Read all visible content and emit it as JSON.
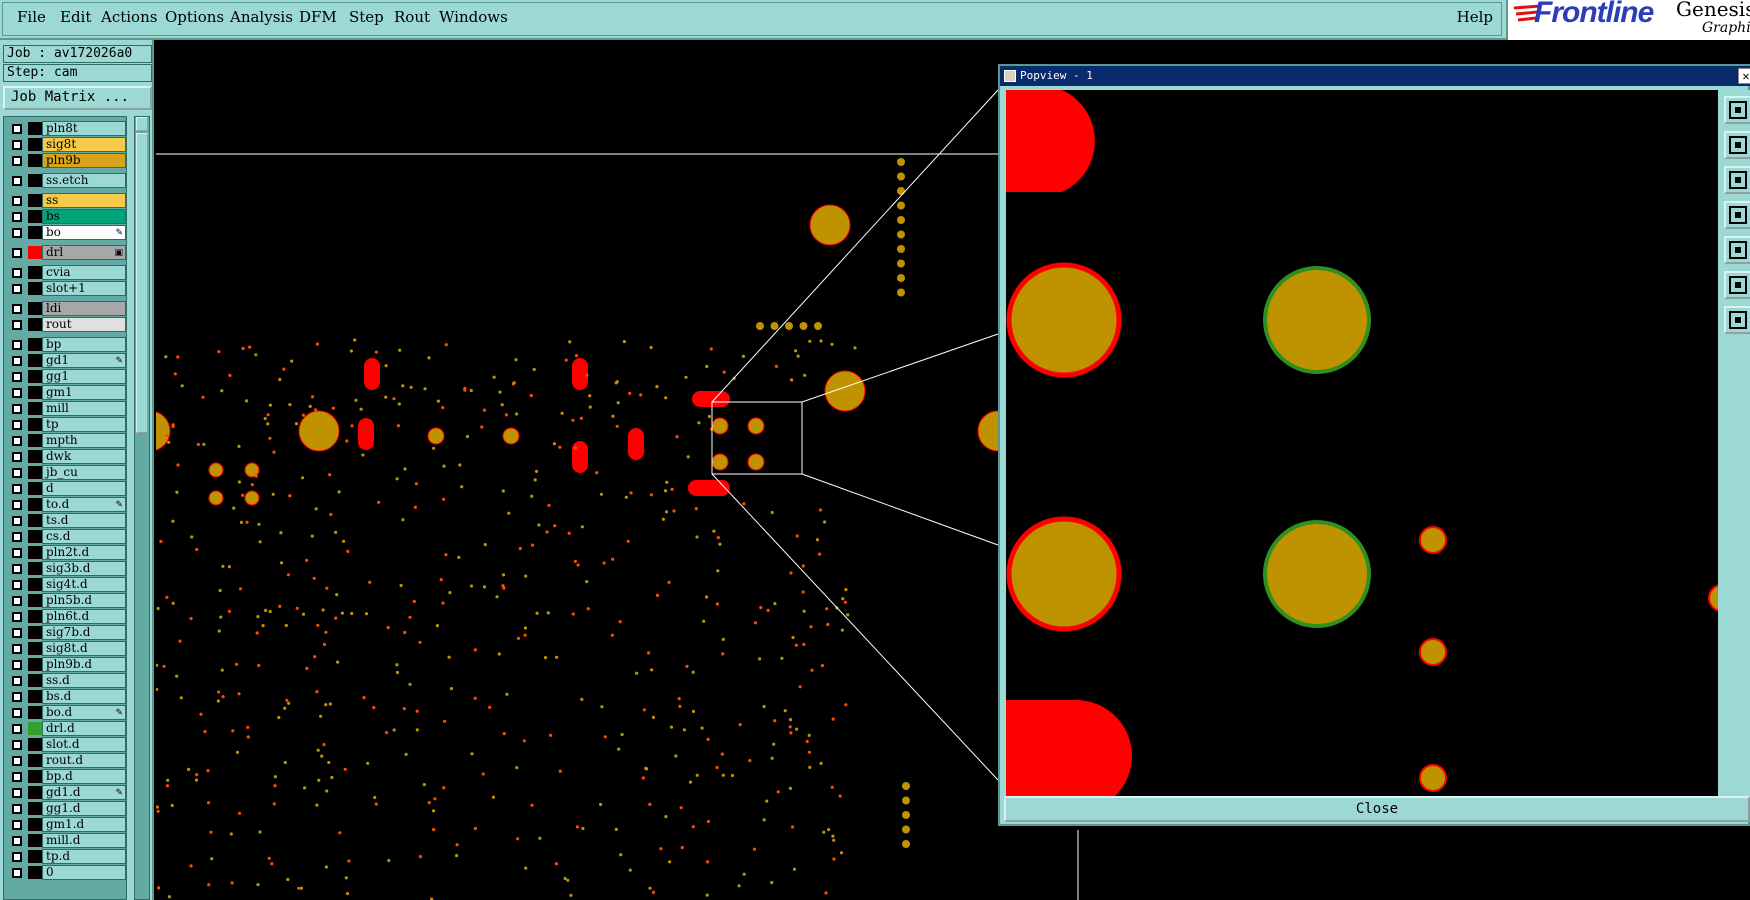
{
  "menubar": {
    "items": [
      {
        "label": "File"
      },
      {
        "label": "Edit"
      },
      {
        "label": "Actions"
      },
      {
        "label": "Options"
      },
      {
        "label": "Analysis"
      },
      {
        "label": "DFM"
      },
      {
        "label": "Step"
      },
      {
        "label": "Rout"
      },
      {
        "label": "Windows"
      }
    ],
    "help_label": "Help"
  },
  "brand": {
    "logo": "Frontline",
    "name": "Genesis",
    "subtitle": "Graphic"
  },
  "job": {
    "job_label": "Job : av172026a0",
    "step_label": "Step: cam",
    "matrix_button": "Job Matrix ..."
  },
  "layers": [
    {
      "name": "pln8t",
      "color": "#000000",
      "bg": "#9cd8d4",
      "mark": ""
    },
    {
      "name": "sig8t",
      "color": "#000000",
      "bg": "#f7c94b",
      "mark": ""
    },
    {
      "name": "pln9b",
      "color": "#000000",
      "bg": "#d8a41c",
      "mark": ""
    },
    {
      "name": "ss.etch",
      "color": "#000000",
      "bg": "#9cd8d4",
      "mark": ""
    },
    {
      "name": "ss",
      "color": "#000000",
      "bg": "#f7c94b",
      "mark": ""
    },
    {
      "name": "bs",
      "color": "#000000",
      "bg": "#00a278",
      "mark": ""
    },
    {
      "name": "bo",
      "color": "#000000",
      "bg": "#ffffff",
      "mark": "✎"
    },
    {
      "name": "drl",
      "color": "#ff0000",
      "bg": "#a8a8a8",
      "mark": "▣"
    },
    {
      "name": "cvia",
      "color": "#000000",
      "bg": "#9cd8d4",
      "mark": ""
    },
    {
      "name": "slot+1",
      "color": "#000000",
      "bg": "#9cd8d4",
      "mark": ""
    },
    {
      "name": "ldi",
      "color": "#000000",
      "bg": "#a8a8a8",
      "mark": ""
    },
    {
      "name": "rout",
      "color": "#000000",
      "bg": "#e0e0e0",
      "mark": ""
    },
    {
      "name": "bp",
      "color": "#000000",
      "bg": "#9cd8d4",
      "mark": ""
    },
    {
      "name": "gd1",
      "color": "#000000",
      "bg": "#9cd8d4",
      "mark": "✎"
    },
    {
      "name": "gg1",
      "color": "#000000",
      "bg": "#9cd8d4",
      "mark": ""
    },
    {
      "name": "gm1",
      "color": "#000000",
      "bg": "#9cd8d4",
      "mark": ""
    },
    {
      "name": "mill",
      "color": "#000000",
      "bg": "#9cd8d4",
      "mark": ""
    },
    {
      "name": "tp",
      "color": "#000000",
      "bg": "#9cd8d4",
      "mark": ""
    },
    {
      "name": "mpth",
      "color": "#000000",
      "bg": "#9cd8d4",
      "mark": ""
    },
    {
      "name": "dwk",
      "color": "#000000",
      "bg": "#9cd8d4",
      "mark": ""
    },
    {
      "name": "jb_cu",
      "color": "#000000",
      "bg": "#9cd8d4",
      "mark": ""
    },
    {
      "name": "d",
      "color": "#000000",
      "bg": "#9cd8d4",
      "mark": ""
    },
    {
      "name": "to.d",
      "color": "#000000",
      "bg": "#9cd8d4",
      "mark": "✎"
    },
    {
      "name": "ts.d",
      "color": "#000000",
      "bg": "#9cd8d4",
      "mark": ""
    },
    {
      "name": "cs.d",
      "color": "#000000",
      "bg": "#9cd8d4",
      "mark": ""
    },
    {
      "name": "pln2t.d",
      "color": "#000000",
      "bg": "#9cd8d4",
      "mark": ""
    },
    {
      "name": "sig3b.d",
      "color": "#000000",
      "bg": "#9cd8d4",
      "mark": ""
    },
    {
      "name": "sig4t.d",
      "color": "#000000",
      "bg": "#9cd8d4",
      "mark": ""
    },
    {
      "name": "pln5b.d",
      "color": "#000000",
      "bg": "#9cd8d4",
      "mark": ""
    },
    {
      "name": "pln6t.d",
      "color": "#000000",
      "bg": "#9cd8d4",
      "mark": ""
    },
    {
      "name": "sig7b.d",
      "color": "#000000",
      "bg": "#9cd8d4",
      "mark": ""
    },
    {
      "name": "sig8t.d",
      "color": "#000000",
      "bg": "#9cd8d4",
      "mark": ""
    },
    {
      "name": "pln9b.d",
      "color": "#000000",
      "bg": "#9cd8d4",
      "mark": ""
    },
    {
      "name": "ss.d",
      "color": "#000000",
      "bg": "#9cd8d4",
      "mark": ""
    },
    {
      "name": "bs.d",
      "color": "#000000",
      "bg": "#9cd8d4",
      "mark": ""
    },
    {
      "name": "bo.d",
      "color": "#000000",
      "bg": "#9cd8d4",
      "mark": "✎"
    },
    {
      "name": "drl.d",
      "color": "#35a02a",
      "bg": "#9cd8d4",
      "mark": ""
    },
    {
      "name": "slot.d",
      "color": "#000000",
      "bg": "#9cd8d4",
      "mark": ""
    },
    {
      "name": "rout.d",
      "color": "#000000",
      "bg": "#9cd8d4",
      "mark": ""
    },
    {
      "name": "bp.d",
      "color": "#000000",
      "bg": "#9cd8d4",
      "mark": ""
    },
    {
      "name": "gd1.d",
      "color": "#000000",
      "bg": "#9cd8d4",
      "mark": "✎"
    },
    {
      "name": "gg1.d",
      "color": "#000000",
      "bg": "#9cd8d4",
      "mark": ""
    },
    {
      "name": "gm1.d",
      "color": "#000000",
      "bg": "#9cd8d4",
      "mark": ""
    },
    {
      "name": "mill.d",
      "color": "#000000",
      "bg": "#9cd8d4",
      "mark": ""
    },
    {
      "name": "tp.d",
      "color": "#000000",
      "bg": "#9cd8d4",
      "mark": ""
    },
    {
      "name": "0",
      "color": "#000000",
      "bg": "#9cd8d4",
      "mark": ""
    }
  ],
  "popview": {
    "title": "Popview - 1",
    "close_label": "Close",
    "tools": [
      "fit-icon",
      "zoom-in-icon",
      "zoom-out-icon",
      "pan-left-icon",
      "pan-right-icon",
      "fit-screen-icon",
      "pan-icon"
    ]
  },
  "colors": {
    "panel": "#9cd8d4",
    "pad_fill": "#bf9300",
    "pad_red": "#ff0000",
    "pad_green": "#2f8f1f",
    "trace": "#ff4a00"
  }
}
